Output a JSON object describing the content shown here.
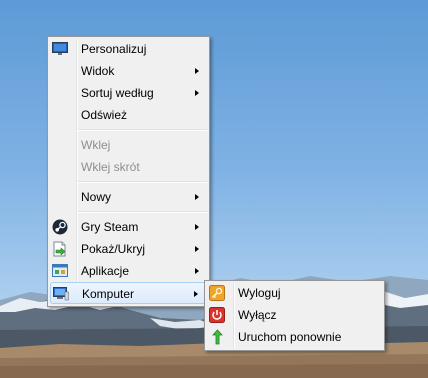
{
  "context_menu": {
    "items": [
      {
        "label": "Personalizuj",
        "icon": "monitor-icon"
      },
      {
        "label": "Widok",
        "submenu": true
      },
      {
        "label": "Sortuj według",
        "submenu": true
      },
      {
        "label": "Odśwież"
      },
      {
        "label": "Wklej",
        "disabled": true
      },
      {
        "label": "Wklej skrót",
        "disabled": true
      },
      {
        "label": "Nowy",
        "submenu": true
      },
      {
        "label": "Gry Steam",
        "icon": "steam-icon",
        "submenu": true
      },
      {
        "label": "Pokaż/Ukryj",
        "icon": "show-hide-icon",
        "submenu": true
      },
      {
        "label": "Aplikacje",
        "icon": "applications-icon",
        "submenu": true
      },
      {
        "label": "Komputer",
        "icon": "computer-icon",
        "submenu": true,
        "highlighted": true
      }
    ]
  },
  "submenu": {
    "items": [
      {
        "label": "Wyloguj",
        "icon": "log-off-icon"
      },
      {
        "label": "Wyłącz",
        "icon": "power-icon"
      },
      {
        "label": "Uruchom ponownie",
        "icon": "restart-icon"
      }
    ]
  },
  "colors": {
    "menu_bg": "#f0f0f0",
    "highlight_border": "#a8d0f5",
    "sky": "#7fb2e4"
  }
}
